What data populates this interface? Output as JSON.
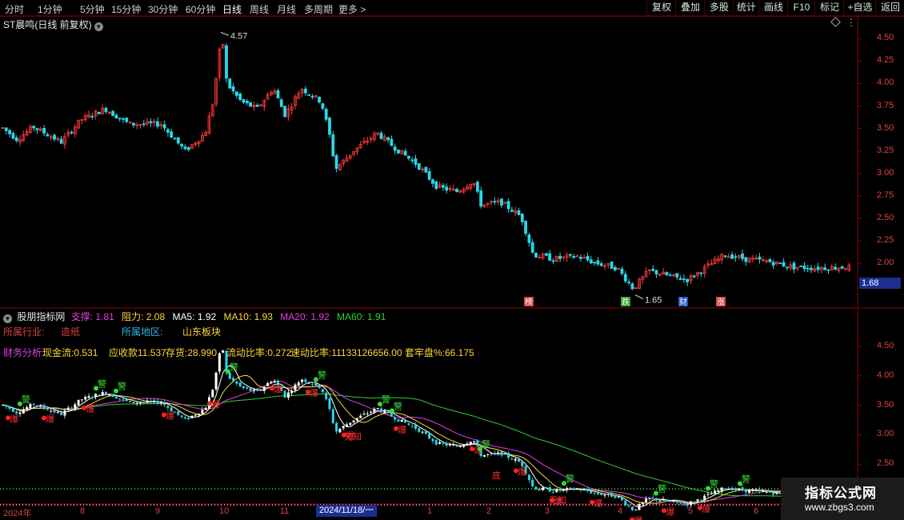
{
  "toolbar": {
    "periods": [
      "分时",
      "1分钟",
      "5分钟",
      "15分钟",
      "30分钟",
      "60分钟",
      "日线",
      "周线",
      "月线",
      "多周期",
      "更多 >"
    ],
    "active_period": "日线",
    "right_buttons": [
      "复权",
      "叠加",
      "多股",
      "统计",
      "画线",
      "F10",
      "标记",
      "+自选",
      "返回"
    ]
  },
  "main_chart": {
    "title": "ST晨鸣(日线 前复权)",
    "high_label": "4.57",
    "low_label": "1.65",
    "last_price": "1.68",
    "y_ticks": [
      "4.50",
      "4.25",
      "4.00",
      "3.75",
      "3.50",
      "3.25",
      "3.00",
      "2.75",
      "2.50",
      "2.25",
      "2.00"
    ],
    "y_range": [
      1.62,
      4.68
    ],
    "tags": [
      {
        "text": "榜",
        "color": "#d04040"
      },
      {
        "text": "跌",
        "color": "#30a030"
      },
      {
        "text": "财",
        "color": "#2050c0"
      },
      {
        "text": "涨",
        "color": "#d04040"
      }
    ]
  },
  "indicator": {
    "name": "股朋指标网",
    "support": {
      "label": "支撑:",
      "value": "1.81"
    },
    "resistance": {
      "label": "阻力:",
      "value": "2.08"
    },
    "ma5": {
      "label": "MA5:",
      "value": "1.92"
    },
    "ma10": {
      "label": "MA10:",
      "value": "1.93"
    },
    "ma20": {
      "label": "MA20:",
      "value": "1.92"
    },
    "ma60": {
      "label": "MA60:",
      "value": "1.91"
    },
    "industry_label": "所属行业:",
    "industry_value": "造纸",
    "region_label": "所属地区:",
    "region_value": "山东板块",
    "finance_label": "财务分析:",
    "finance_items": [
      "现金流:0.531",
      "应收款11.537",
      "存货:28.990",
      "流动比率:0.272",
      "速动比率:11133126656.00",
      "套牢盘%:66.175"
    ],
    "y_ticks": [
      "4.50",
      "4.00",
      "3.50",
      "3.00",
      "2.50",
      "2.00"
    ],
    "y_range": [
      1.85,
      4.95
    ],
    "signal_buy": "警",
    "signal_sell": "爆",
    "bottom_signal": "底",
    "unknown_signal": "无知"
  },
  "x_axis": {
    "labels": [
      "2024年",
      "8",
      "9",
      "10",
      "11",
      "2024/11/18/一",
      "1",
      "2",
      "3",
      "4",
      "5",
      "6"
    ]
  },
  "watermark": {
    "title": "指标公式网",
    "url": "www.zbgs3.com"
  },
  "colors": {
    "up": "#ff3a3a",
    "down": "#28d8e8",
    "ma5": "#ffffff",
    "ma10": "#ffd83a",
    "ma20": "#e040e0",
    "ma60": "#30d030",
    "axis": "#8b0000"
  }
}
